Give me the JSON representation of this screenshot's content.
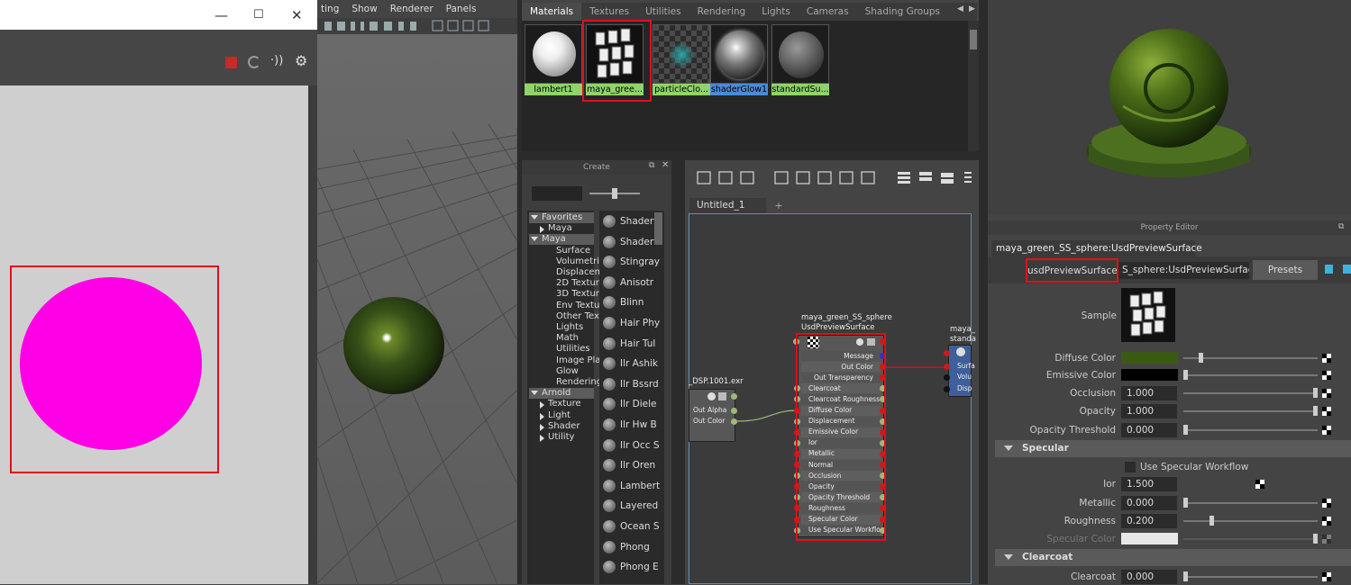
{
  "render_window": {
    "title_buttons": [
      "—",
      "☐",
      "✕"
    ]
  },
  "viewport": {
    "menus": [
      "ting",
      "Show",
      "Renderer",
      "Panels"
    ]
  },
  "hypershade": {
    "tabs": [
      "Materials",
      "Textures",
      "Utilities",
      "Rendering",
      "Lights",
      "Cameras",
      "Shading Groups"
    ],
    "materials": [
      {
        "label": "lambert1",
        "selected": false
      },
      {
        "label": "maya_gree...",
        "selected": true
      },
      {
        "label": "particleClo...",
        "selected": false
      },
      {
        "label": "shaderGlow1",
        "selected": false
      },
      {
        "label": "standardSu...",
        "selected": false
      }
    ]
  },
  "create_panel": {
    "title": "Create",
    "tree": [
      {
        "label": "Favorites",
        "indent": 0,
        "header": true,
        "expanded": true
      },
      {
        "label": "Maya",
        "indent": 1,
        "header": false,
        "collapsed": true
      },
      {
        "label": "Maya",
        "indent": 0,
        "header": true,
        "expanded": true
      },
      {
        "label": "Surface",
        "indent": 2
      },
      {
        "label": "Volumetric",
        "indent": 2
      },
      {
        "label": "Displacem",
        "indent": 2
      },
      {
        "label": "2D Texture",
        "indent": 2
      },
      {
        "label": "3D Texture",
        "indent": 2
      },
      {
        "label": "Env Textur",
        "indent": 2
      },
      {
        "label": "Other Text",
        "indent": 2
      },
      {
        "label": "Lights",
        "indent": 2
      },
      {
        "label": "Math",
        "indent": 2
      },
      {
        "label": "Utilities",
        "indent": 2
      },
      {
        "label": "Image Plar",
        "indent": 2
      },
      {
        "label": "Glow",
        "indent": 2
      },
      {
        "label": "Rendering",
        "indent": 2
      },
      {
        "label": "Arnold",
        "indent": 0,
        "header": true,
        "expanded": true
      },
      {
        "label": "Texture",
        "indent": 1,
        "collapsed": true
      },
      {
        "label": "Light",
        "indent": 1,
        "collapsed": true
      },
      {
        "label": "Shader",
        "indent": 1,
        "collapsed": true
      },
      {
        "label": "Utility",
        "indent": 1,
        "collapsed": true
      }
    ],
    "shaders": [
      "Shaderf",
      "Shaderf",
      "Stingray",
      "Anisotr",
      "Blinn",
      "Hair Phy",
      "Hair Tul",
      "Ilr Ashik",
      "Ilr Bssrd",
      "Ilr Diele",
      "Ilr Hw B",
      "Ilr Occ S",
      "Ilr Oren",
      "Lambert",
      "Layered",
      "Ocean S",
      "Phong",
      "Phong E"
    ]
  },
  "node_editor": {
    "tab": "Untitled_1",
    "plus": "+",
    "file_node": {
      "label": "_DSP.1001.exr",
      "ports": [
        "Out Alpha",
        "Out Color"
      ]
    },
    "main_node": {
      "title1": "maya_green_SS_sphere",
      "title2": "UsdPreviewSurface",
      "outputs": [
        "Message",
        "Out Color",
        "Out Transparency"
      ],
      "inputs": [
        "Clearcoat",
        "Clearcoat Roughness",
        "Diffuse Color",
        "Displacement",
        "Emissive Color",
        "Ior",
        "Metallic",
        "Normal",
        "Occlusion",
        "Opacity",
        "Opacity Threshold",
        "Roughness",
        "Specular Color",
        "Use Specular Workflow"
      ]
    },
    "sg_node": {
      "title1": "maya_",
      "title2": "standa",
      "ports": [
        "Surfa",
        "Volu",
        "Disp"
      ]
    }
  },
  "property_editor": {
    "title": "Property Editor",
    "node_tab": "maya_green_SS_sphere:UsdPreviewSurface",
    "type_label": "usdPreviewSurface:",
    "name_value": "S_sphere:UsdPreviewSurface",
    "presets": "Presets",
    "sample_label": "Sample",
    "rows": [
      {
        "label": "Diffuse Color",
        "type": "color",
        "color": "#3a5a14",
        "knob": 0.12
      },
      {
        "label": "Emissive Color",
        "type": "color",
        "color": "#000000",
        "knob": 0.0
      },
      {
        "label": "Occlusion",
        "value": "1.000",
        "knob": 1.0
      },
      {
        "label": "Opacity",
        "value": "1.000",
        "knob": 1.0
      },
      {
        "label": "Opacity Threshold",
        "value": "0.000",
        "knob": 0.0
      }
    ],
    "specular_section": "Specular",
    "use_specular_workflow": "Use Specular Workflow",
    "specular_rows": [
      {
        "label": "Ior",
        "value": "1.500"
      },
      {
        "label": "Metallic",
        "value": "0.000",
        "knob": 0.0
      },
      {
        "label": "Roughness",
        "value": "0.200",
        "knob": 0.2
      },
      {
        "label": "Specular Color",
        "type": "color",
        "color": "#e8e8e8",
        "knob": 1.0,
        "dim": true
      }
    ],
    "clearcoat_section": "Clearcoat",
    "clearcoat_rows": [
      {
        "label": "Clearcoat",
        "value": "0.000",
        "knob": 0.0
      }
    ]
  }
}
